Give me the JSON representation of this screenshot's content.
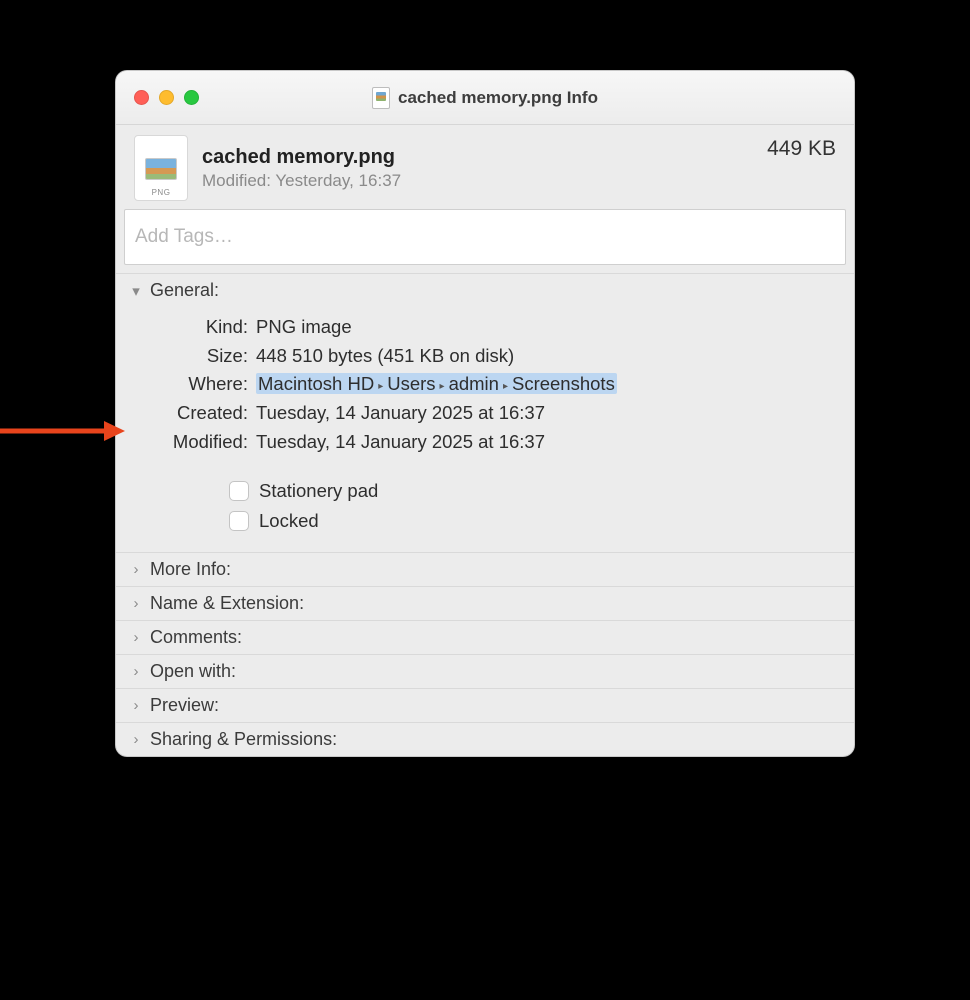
{
  "window": {
    "title": "cached memory.png Info"
  },
  "header": {
    "filename": "cached memory.png",
    "modified_line": "Modified: Yesterday, 16:37",
    "size": "449 KB",
    "thumb_badge": "PNG"
  },
  "tags": {
    "placeholder": "Add Tags…"
  },
  "general": {
    "title": "General:",
    "rows": {
      "kind_label": "Kind:",
      "kind_value": "PNG image",
      "size_label": "Size:",
      "size_value": "448 510 bytes (451 KB on disk)",
      "where_label": "Where:",
      "where_path": [
        "Macintosh HD",
        "Users",
        "admin",
        "Screenshots"
      ],
      "created_label": "Created:",
      "created_value": "Tuesday, 14 January 2025 at 16:37",
      "modified_label": "Modified:",
      "modified_value": "Tuesday, 14 January 2025 at 16:37"
    },
    "checks": {
      "stationery": "Stationery pad",
      "locked": "Locked"
    }
  },
  "sections": {
    "more_info": "More Info:",
    "name_ext": "Name & Extension:",
    "comments": "Comments:",
    "open_with": "Open with:",
    "preview": "Preview:",
    "sharing": "Sharing & Permissions:"
  },
  "annotation": {
    "arrow_color": "#e8441c"
  }
}
